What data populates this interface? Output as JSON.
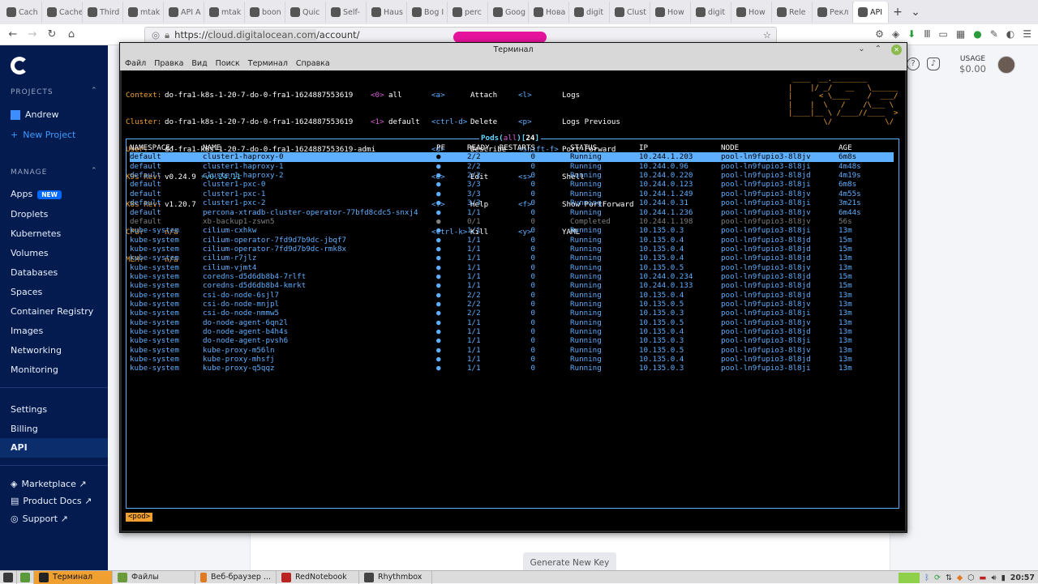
{
  "browser": {
    "tabs": [
      "Cach",
      "Cachet: T",
      "Third",
      "mtak",
      "API A",
      "mtak",
      "boon",
      "Quic",
      "Self-",
      "Haus",
      "Bog I",
      "perc",
      "Goog",
      "Нова",
      "digit",
      "Clust",
      "How",
      "digit",
      "How",
      "Rele",
      "Рекл",
      "API"
    ],
    "url_prefix": "https://",
    "url_domain": "cloud.digitalocean.com",
    "url_path": "/account/"
  },
  "sidebar": {
    "projects_header": "PROJECTS",
    "project_name": "Andrew",
    "new_project": "New Project",
    "manage_header": "MANAGE",
    "apps_label": "Apps",
    "new_badge": "NEW",
    "items": [
      "Droplets",
      "Kubernetes",
      "Volumes",
      "Databases",
      "Spaces",
      "Container Registry",
      "Images",
      "Networking",
      "Monitoring"
    ],
    "settings": "Settings",
    "billing": "Billing",
    "api": "API",
    "marketplace": "Marketplace ↗",
    "product_docs": "Product Docs ↗",
    "support": "Support ↗"
  },
  "header": {
    "usage_label": "USAGE",
    "usage_value": "$0.00"
  },
  "page": {
    "generate_button": "Generate New Key"
  },
  "terminal": {
    "title": "Терминал",
    "menu": [
      "Файл",
      "Правка",
      "Вид",
      "Поиск",
      "Терминал",
      "Справка"
    ],
    "info": {
      "context_label": "Context:",
      "context": "do-fra1-k8s-1-20-7-do-0-fra1-1624887553619",
      "cluster_label": "Cluster:",
      "cluster": "do-fra1-k8s-1-20-7-do-0-fra1-1624887553619",
      "user_label": "User:",
      "user": "do-fra1-k8s-1-20-7-do-0-fra1-1624887553619-admi",
      "k9s_label": "K9s Rev:",
      "k9s": "v0.24.9",
      "k9s_new": "⚡v0.24.11",
      "k8s_label": "K8s Rev:",
      "k8s": "v1.20.7",
      "cpu_label": "CPU:",
      "cpu": "n/a",
      "mem_label": "MEM:",
      "mem": "n/a"
    },
    "namespaces": [
      [
        "<0>",
        "all"
      ],
      [
        "<1>",
        "default"
      ]
    ],
    "shortcuts1": [
      [
        "<a>",
        "Attach"
      ],
      [
        "<ctrl-d>",
        "Delete"
      ],
      [
        "<d>",
        "Describe"
      ],
      [
        "<e>",
        "Edit"
      ],
      [
        "<?>",
        "Help"
      ],
      [
        "<ctrl-k>",
        "Kill"
      ]
    ],
    "shortcuts2": [
      [
        "<l>",
        "Logs"
      ],
      [
        "<p>",
        "Logs Previous"
      ],
      [
        "<shift-f>",
        "Port-Forward"
      ],
      [
        "<s>",
        "Shell"
      ],
      [
        "<f>",
        "Show PortForward"
      ],
      [
        "<y>",
        "YAML"
      ]
    ],
    "pods_title": "Pods",
    "pods_scope": "all",
    "pods_count": "24",
    "columns": [
      "NAMESPACE↑",
      "NAME",
      "PF",
      "READY",
      "RESTARTS",
      "STATUS",
      "IP",
      "NODE",
      "AGE"
    ],
    "rows": [
      [
        "default",
        "cluster1-haproxy-0",
        "●",
        "2/2",
        "0",
        "Running",
        "10.244.1.203",
        "pool-ln9fupio3-8l8jv",
        "6m8s"
      ],
      [
        "default",
        "cluster1-haproxy-1",
        "●",
        "2/2",
        "0",
        "Running",
        "10.244.0.96",
        "pool-ln9fupio3-8l8ji",
        "4m48s"
      ],
      [
        "default",
        "cluster1-haproxy-2",
        "●",
        "2/2",
        "0",
        "Running",
        "10.244.0.220",
        "pool-ln9fupio3-8l8jd",
        "4m19s"
      ],
      [
        "default",
        "cluster1-pxc-0",
        "●",
        "3/3",
        "0",
        "Running",
        "10.244.0.123",
        "pool-ln9fupio3-8l8ji",
        "6m8s"
      ],
      [
        "default",
        "cluster1-pxc-1",
        "●",
        "3/3",
        "0",
        "Running",
        "10.244.1.249",
        "pool-ln9fupio3-8l8jv",
        "4m55s"
      ],
      [
        "default",
        "cluster1-pxc-2",
        "●",
        "3/3",
        "0",
        "Running",
        "10.244.0.31",
        "pool-ln9fupio3-8l8ji",
        "3m21s"
      ],
      [
        "default",
        "percona-xtradb-cluster-operator-77bfd8cdc5-snxj4",
        "●",
        "1/1",
        "0",
        "Running",
        "10.244.1.236",
        "pool-ln9fupio3-8l8jv",
        "6m44s"
      ],
      [
        "default",
        "xb-backup1-zswn5",
        "●",
        "0/1",
        "0",
        "Completed",
        "10.244.1.198",
        "pool-ln9fupio3-8l8jv",
        "56s"
      ],
      [
        "kube-system",
        "cilium-cxhkw",
        "●",
        "1/1",
        "0",
        "Running",
        "10.135.0.3",
        "pool-ln9fupio3-8l8ji",
        "13m"
      ],
      [
        "kube-system",
        "cilium-operator-7fd9d7b9dc-jbqf7",
        "●",
        "1/1",
        "0",
        "Running",
        "10.135.0.4",
        "pool-ln9fupio3-8l8jd",
        "15m"
      ],
      [
        "kube-system",
        "cilium-operator-7fd9d7b9dc-rmk8x",
        "●",
        "1/1",
        "0",
        "Running",
        "10.135.0.4",
        "pool-ln9fupio3-8l8jd",
        "15m"
      ],
      [
        "kube-system",
        "cilium-r7jlz",
        "●",
        "1/1",
        "0",
        "Running",
        "10.135.0.4",
        "pool-ln9fupio3-8l8jd",
        "13m"
      ],
      [
        "kube-system",
        "cilium-vjmt4",
        "●",
        "1/1",
        "0",
        "Running",
        "10.135.0.5",
        "pool-ln9fupio3-8l8jv",
        "13m"
      ],
      [
        "kube-system",
        "coredns-d5d6db8b4-7rlft",
        "●",
        "1/1",
        "0",
        "Running",
        "10.244.0.234",
        "pool-ln9fupio3-8l8jd",
        "15m"
      ],
      [
        "kube-system",
        "coredns-d5d6db8b4-kmrkt",
        "●",
        "1/1",
        "0",
        "Running",
        "10.244.0.133",
        "pool-ln9fupio3-8l8jd",
        "15m"
      ],
      [
        "kube-system",
        "csi-do-node-6sjl7",
        "●",
        "2/2",
        "0",
        "Running",
        "10.135.0.4",
        "pool-ln9fupio3-8l8jd",
        "13m"
      ],
      [
        "kube-system",
        "csi-do-node-mnjpl",
        "●",
        "2/2",
        "0",
        "Running",
        "10.135.0.5",
        "pool-ln9fupio3-8l8jv",
        "13m"
      ],
      [
        "kube-system",
        "csi-do-node-nmmw5",
        "●",
        "2/2",
        "0",
        "Running",
        "10.135.0.3",
        "pool-ln9fupio3-8l8ji",
        "13m"
      ],
      [
        "kube-system",
        "do-node-agent-6qn2l",
        "●",
        "1/1",
        "0",
        "Running",
        "10.135.0.5",
        "pool-ln9fupio3-8l8jv",
        "13m"
      ],
      [
        "kube-system",
        "do-node-agent-b4h4s",
        "●",
        "1/1",
        "0",
        "Running",
        "10.135.0.4",
        "pool-ln9fupio3-8l8jd",
        "13m"
      ],
      [
        "kube-system",
        "do-node-agent-pvsh6",
        "●",
        "1/1",
        "0",
        "Running",
        "10.135.0.3",
        "pool-ln9fupio3-8l8ji",
        "13m"
      ],
      [
        "kube-system",
        "kube-proxy-m56ln",
        "●",
        "1/1",
        "0",
        "Running",
        "10.135.0.5",
        "pool-ln9fupio3-8l8jv",
        "13m"
      ],
      [
        "kube-system",
        "kube-proxy-mhsfj",
        "●",
        "1/1",
        "0",
        "Running",
        "10.135.0.4",
        "pool-ln9fupio3-8l8jd",
        "13m"
      ],
      [
        "kube-system",
        "kube-proxy-q5qqz",
        "●",
        "1/1",
        "0",
        "Running",
        "10.135.0.3",
        "pool-ln9fupio3-8l8ji",
        "13m"
      ]
    ],
    "selected_row": 0,
    "completed_row": 7,
    "crumb": "<pod>"
  },
  "taskbar": {
    "apps": [
      "Терминал",
      "Файлы",
      "Веб-браузер ...",
      "RedNotebook",
      "Rhythmbox"
    ],
    "clock": "20:57"
  }
}
